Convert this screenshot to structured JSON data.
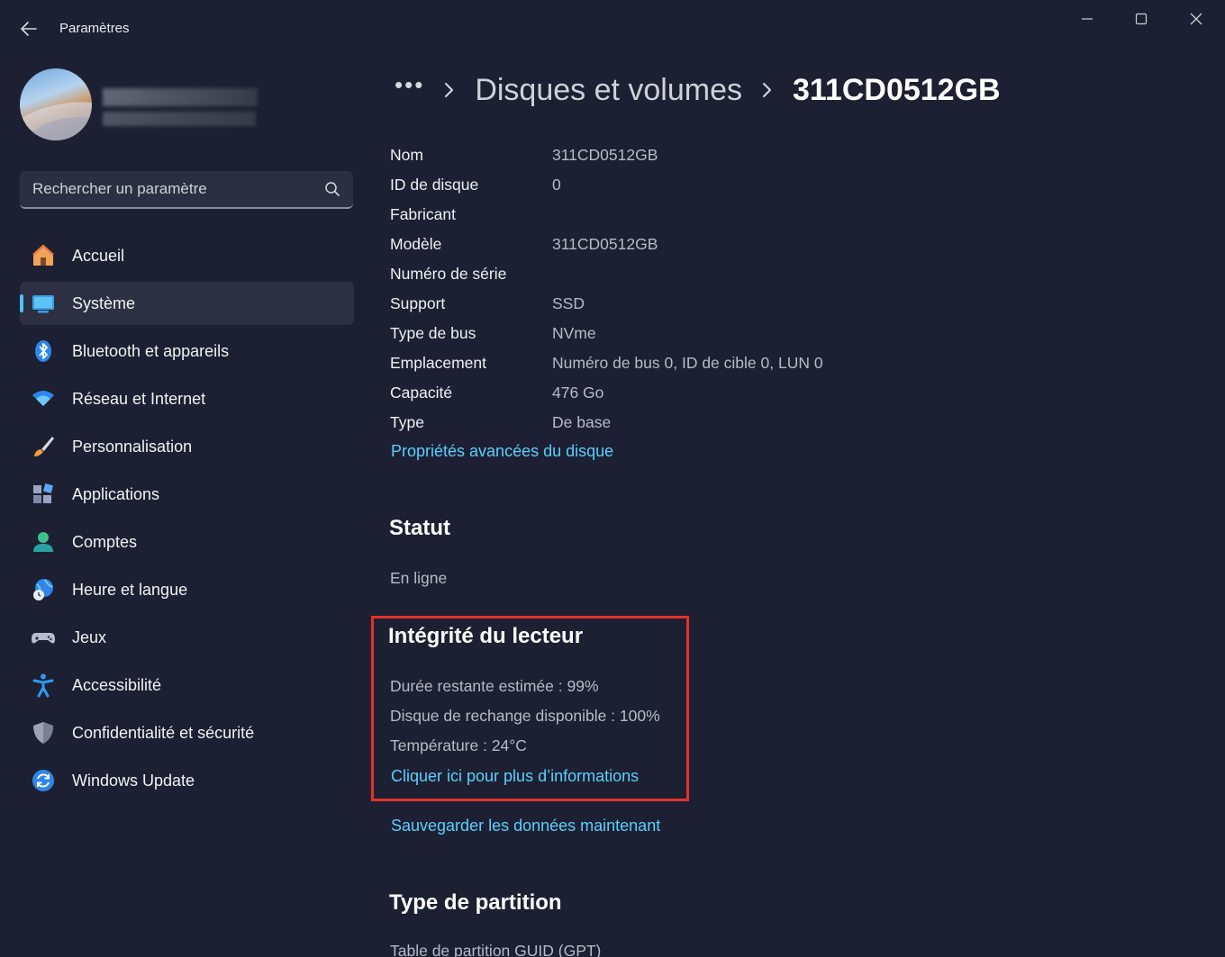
{
  "window": {
    "title": "Paramètres",
    "back_icon": "back-arrow-icon",
    "controls": [
      "minimize-icon",
      "maximize-icon",
      "close-icon"
    ]
  },
  "sidebar": {
    "search": {
      "placeholder": "Rechercher un paramètre",
      "value": ""
    },
    "items": [
      {
        "label": "Accueil",
        "icon": "home-icon",
        "active": false
      },
      {
        "label": "Système",
        "icon": "system-icon",
        "active": true
      },
      {
        "label": "Bluetooth et appareils",
        "icon": "bluetooth-icon",
        "active": false
      },
      {
        "label": "Réseau et Internet",
        "icon": "wifi-icon",
        "active": false
      },
      {
        "label": "Personnalisation",
        "icon": "brush-icon",
        "active": false
      },
      {
        "label": "Applications",
        "icon": "apps-icon",
        "active": false
      },
      {
        "label": "Comptes",
        "icon": "person-icon",
        "active": false
      },
      {
        "label": "Heure et langue",
        "icon": "globe-clock-icon",
        "active": false
      },
      {
        "label": "Jeux",
        "icon": "gamepad-icon",
        "active": false
      },
      {
        "label": "Accessibilité",
        "icon": "accessibility-icon",
        "active": false
      },
      {
        "label": "Confidentialité et sécurité",
        "icon": "shield-icon",
        "active": false
      },
      {
        "label": "Windows Update",
        "icon": "update-icon",
        "active": false
      }
    ]
  },
  "breadcrumb": {
    "more": "•••",
    "parent": "Disques et volumes",
    "current": "311CD0512GB"
  },
  "properties": [
    {
      "label": "Nom",
      "value": "311CD0512GB"
    },
    {
      "label": "ID de disque",
      "value": "0"
    },
    {
      "label": "Fabricant",
      "value": ""
    },
    {
      "label": "Modèle",
      "value": "311CD0512GB"
    },
    {
      "label": "Numéro de série",
      "value": ""
    },
    {
      "label": "Support",
      "value": "SSD"
    },
    {
      "label": "Type de bus",
      "value": "NVme"
    },
    {
      "label": "Emplacement",
      "value": "Numéro de bus 0, ID de cible 0, LUN 0"
    },
    {
      "label": "Capacité",
      "value": "476 Go"
    },
    {
      "label": "Type",
      "value": "De base"
    }
  ],
  "advanced_link": "Propriétés avancées du disque",
  "status": {
    "title": "Statut",
    "value": "En ligne"
  },
  "health": {
    "title": "Intégrité du lecteur",
    "lines": [
      "Durée restante estimée : 99%",
      "Disque de rechange disponible : 100%",
      "Température : 24°C"
    ],
    "more_link": "Cliquer ici pour plus d’informations",
    "highlight_color": "#e3322a"
  },
  "backup_link": "Sauvegarder les données maintenant",
  "partition": {
    "title": "Type de partition",
    "value": "Table de partition GUID (GPT)"
  },
  "colors": {
    "background": "#1c2032",
    "accent": "#4cc2ff",
    "link": "#5ccfff"
  }
}
